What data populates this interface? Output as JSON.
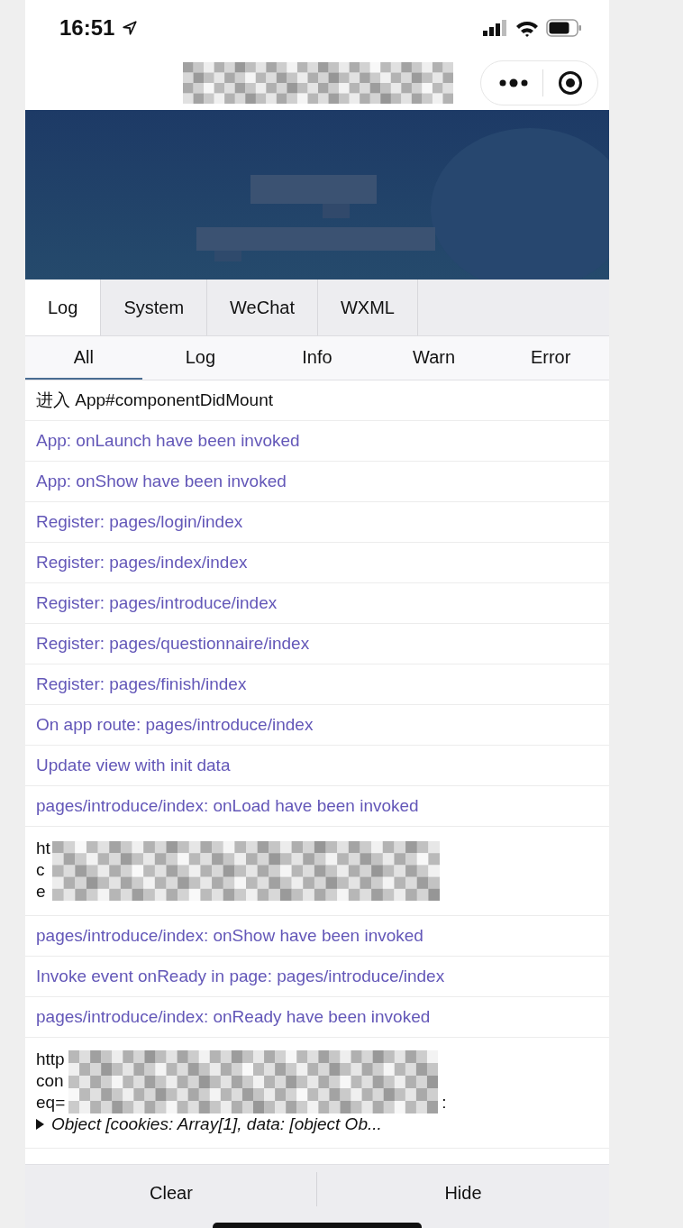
{
  "status_bar": {
    "time": "16:51"
  },
  "tabs": [
    {
      "label": "Log",
      "selected": true
    },
    {
      "label": "System",
      "selected": false
    },
    {
      "label": "WeChat",
      "selected": false
    },
    {
      "label": "WXML",
      "selected": false
    }
  ],
  "filters": [
    {
      "label": "All",
      "selected": true
    },
    {
      "label": "Log",
      "selected": false
    },
    {
      "label": "Info",
      "selected": false
    },
    {
      "label": "Warn",
      "selected": false
    },
    {
      "label": "Error",
      "selected": false
    }
  ],
  "entries": [
    {
      "kind": "log",
      "text": "进入 App#componentDidMount"
    },
    {
      "kind": "info",
      "text": "App: onLaunch have been invoked"
    },
    {
      "kind": "info",
      "text": "App: onShow have been invoked"
    },
    {
      "kind": "info",
      "text": "Register: pages/login/index"
    },
    {
      "kind": "info",
      "text": "Register: pages/index/index"
    },
    {
      "kind": "info",
      "text": "Register: pages/introduce/index"
    },
    {
      "kind": "info",
      "text": "Register: pages/questionnaire/index"
    },
    {
      "kind": "info",
      "text": "Register: pages/finish/index"
    },
    {
      "kind": "info",
      "text": "On app route: pages/introduce/index"
    },
    {
      "kind": "info",
      "text": "Update view with init data"
    },
    {
      "kind": "info",
      "text": "pages/introduce/index: onLoad have been invoked"
    },
    {
      "kind": "redacted",
      "lines": [
        "ht",
        "c",
        "e"
      ]
    },
    {
      "kind": "info",
      "text": "pages/introduce/index: onShow have been invoked"
    },
    {
      "kind": "info",
      "text": "Invoke event onReady in page: pages/introduce/index"
    },
    {
      "kind": "info",
      "text": "pages/introduce/index: onReady have been invoked"
    },
    {
      "kind": "redacted",
      "lines": [
        "http",
        "con",
        "eq="
      ],
      "tail": ":",
      "object": "Object [cookies: Array[1], data: [object Ob..."
    }
  ],
  "buttons": [
    "Clear",
    "Hide"
  ]
}
